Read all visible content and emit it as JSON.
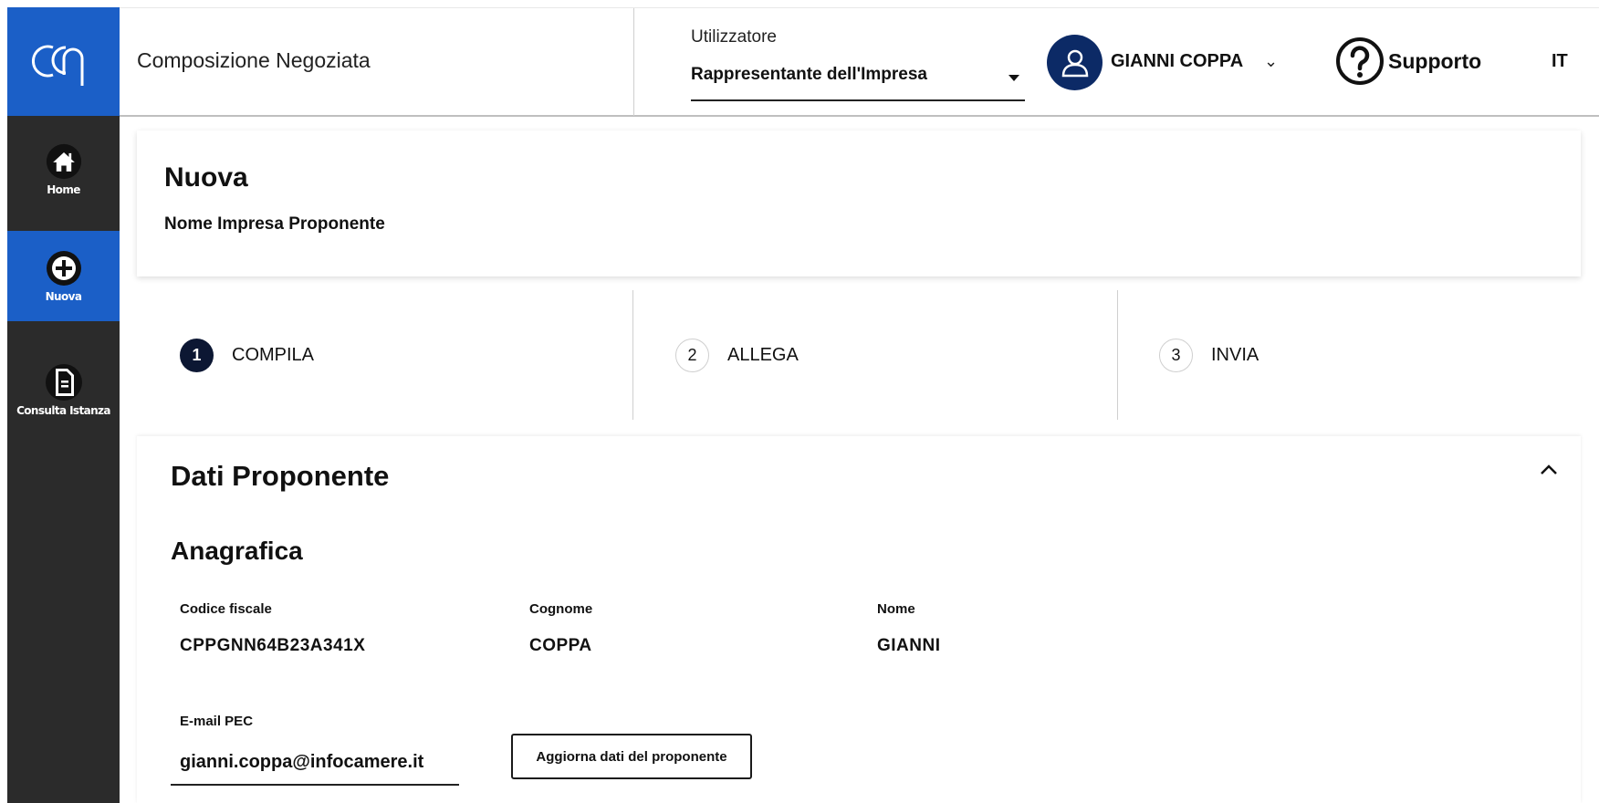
{
  "sidebar": {
    "logo_text": "CCm",
    "items": [
      {
        "label": "Home",
        "icon": "home-icon"
      },
      {
        "label": "Nuova",
        "icon": "plus-circle-icon"
      },
      {
        "label": "Consulta Istanza",
        "icon": "document-icon"
      }
    ]
  },
  "header": {
    "app_title": "Composizione Negoziata",
    "role_label": "Utilizzatore",
    "role_value": "Rappresentante dell'Impresa",
    "user_name": "GIANNI COPPA",
    "support_label": "Supporto",
    "language": "IT"
  },
  "title_card": {
    "title": "Nuova",
    "subtitle": "Nome Impresa Proponente"
  },
  "stepper": {
    "steps": [
      {
        "number": "1",
        "label": "COMPILA",
        "active": true
      },
      {
        "number": "2",
        "label": "ALLEGA",
        "active": false
      },
      {
        "number": "3",
        "label": "INVIA",
        "active": false
      }
    ]
  },
  "section": {
    "title": "Dati Proponente",
    "toggle_icon": "chevron-up-icon",
    "subsection_title": "Anagrafica",
    "fields": {
      "codice_fiscale": {
        "label": "Codice fiscale",
        "value": "CPPGNN64B23A341X"
      },
      "cognome": {
        "label": "Cognome",
        "value": "COPPA"
      },
      "nome": {
        "label": "Nome",
        "value": "GIANNI"
      },
      "email_pec": {
        "label": "E-mail PEC",
        "value": "gianni.coppa@infocamere.it"
      }
    },
    "update_button": "Aggiorna dati del proponente"
  },
  "colors": {
    "brand_blue": "#1b5fc7",
    "sidebar_dark": "#2b2b2b",
    "avatar_navy": "#0c2a66",
    "active_step": "#0c1733"
  }
}
